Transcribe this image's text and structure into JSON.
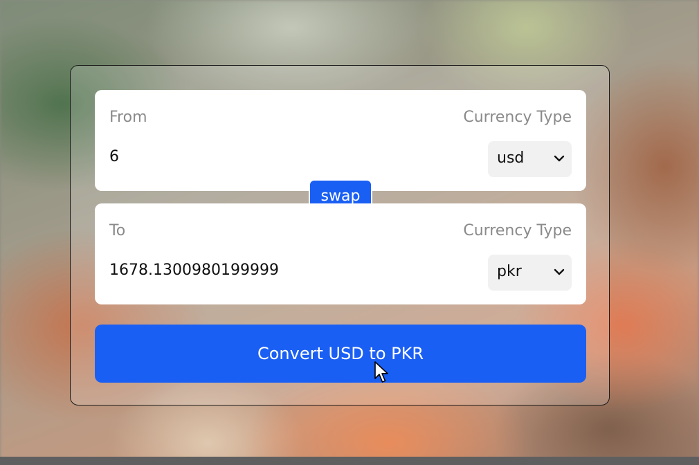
{
  "converter": {
    "from_panel": {
      "label": "From",
      "currency_type_label": "Currency Type",
      "amount_value": "6",
      "currency_selected": "usd"
    },
    "to_panel": {
      "label": "To",
      "currency_type_label": "Currency Type",
      "amount_value": "1678.1300980199999",
      "currency_selected": "pkr"
    },
    "swap_label": "swap",
    "convert_label": "Convert USD to PKR"
  },
  "icons": {
    "select_arrow": "chevron-down-icon",
    "pointer": "mouse-cursor-icon"
  },
  "colors": {
    "accent": "#1a5ff4",
    "panel_bg": "#ffffff",
    "label_text": "#8a8a8a",
    "select_bg": "#f1f1f1"
  }
}
